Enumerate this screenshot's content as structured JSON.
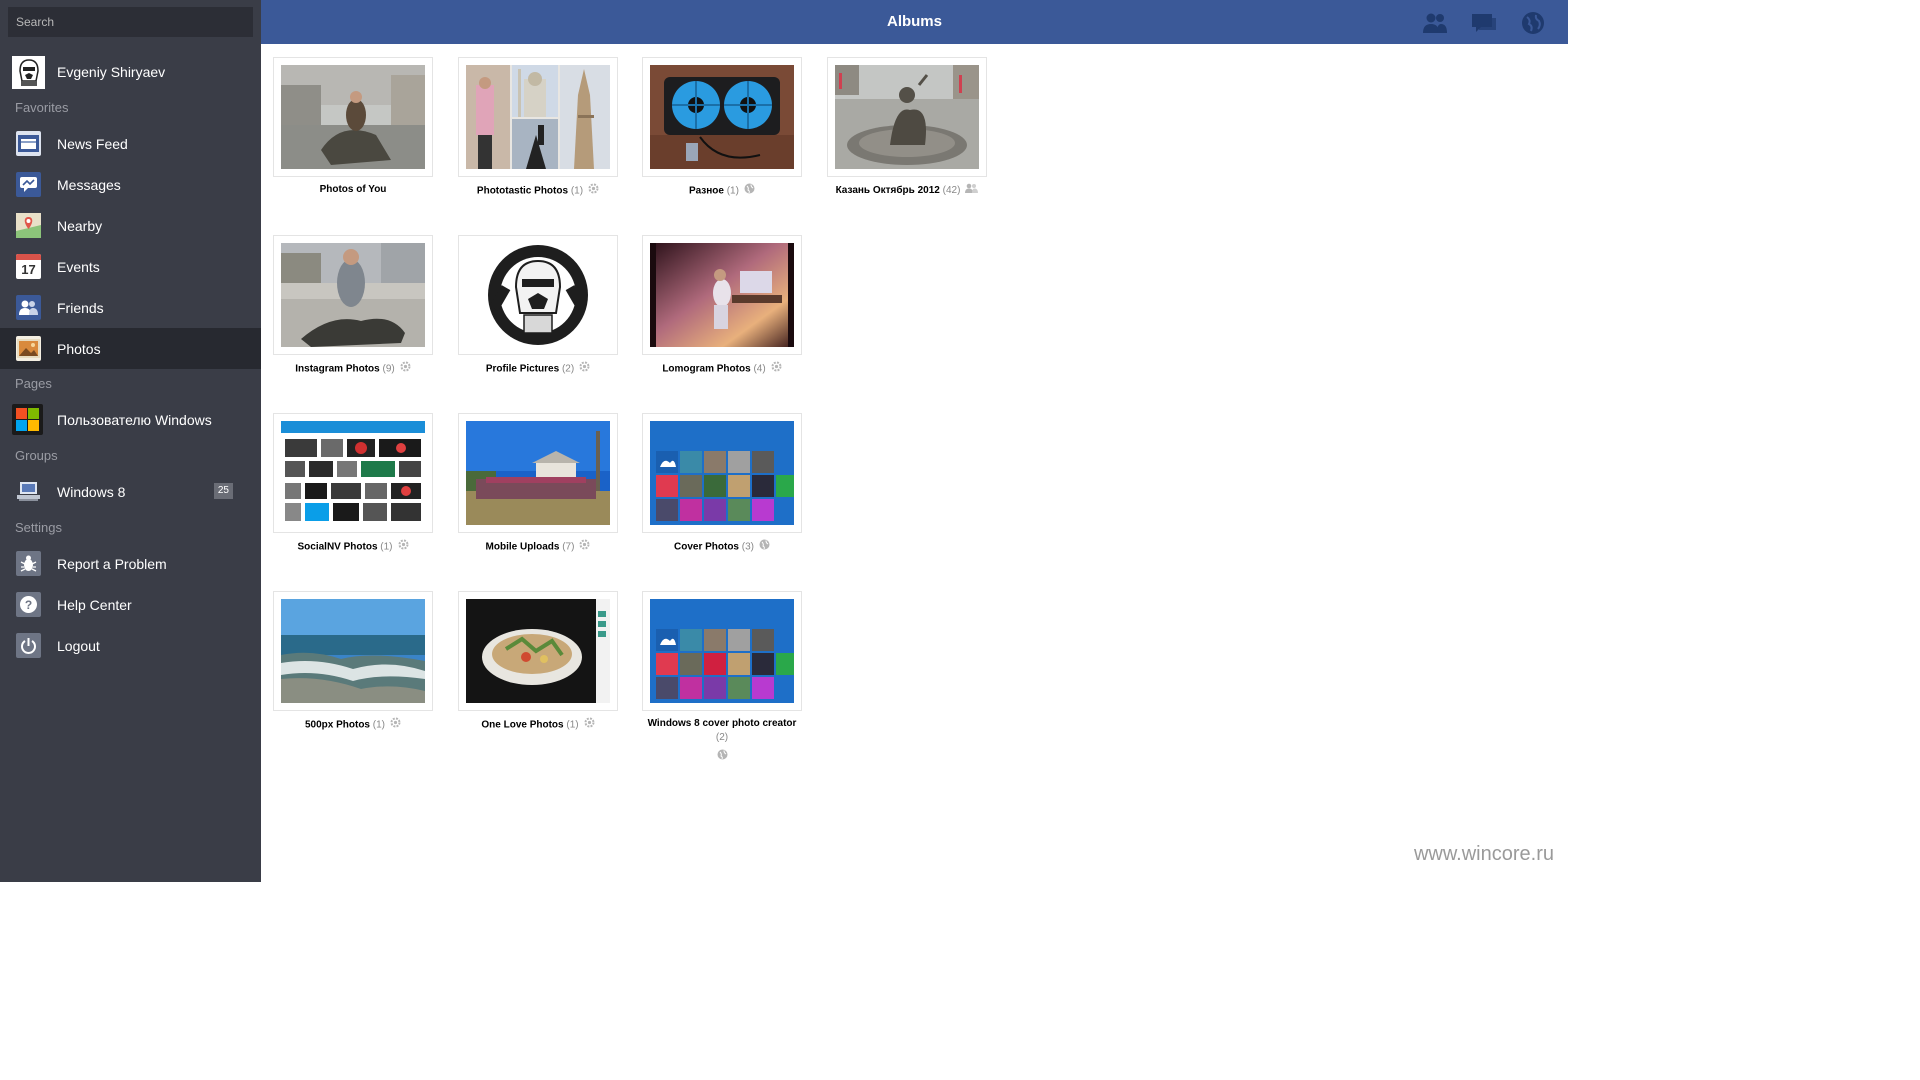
{
  "search": {
    "placeholder": "Search"
  },
  "profile": {
    "name": "Evgeniy  Shiryaev"
  },
  "sections": {
    "favorites": "Favorites",
    "pages": "Pages",
    "groups": "Groups",
    "settings": "Settings"
  },
  "nav": {
    "news_feed": "News Feed",
    "messages": "Messages",
    "nearby": "Nearby",
    "events": "Events",
    "events_icon_day": "17",
    "friends": "Friends",
    "photos": "Photos"
  },
  "pages_item": "Пользователю Windows",
  "groups_item": {
    "label": "Windows 8",
    "badge": "25"
  },
  "settings_items": {
    "report": "Report a Problem",
    "help": "Help Center",
    "logout": "Logout"
  },
  "header": {
    "title": "Albums"
  },
  "albums": [
    {
      "title": "Photos of You",
      "count": "",
      "privacy": ""
    },
    {
      "title": "Phototastic Photos",
      "count": "(1)",
      "privacy": "gear-icon"
    },
    {
      "title": "Разное",
      "count": "(1)",
      "privacy": "globe-icon"
    },
    {
      "title": "Казань Октябрь 2012",
      "count": "(42)",
      "privacy": "friends-icon"
    },
    {
      "title": "Instagram Photos",
      "count": "(9)",
      "privacy": "gear-icon"
    },
    {
      "title": "Profile Pictures",
      "count": "(2)",
      "privacy": "gear-icon"
    },
    {
      "title": "Lomogram Photos",
      "count": "(4)",
      "privacy": "gear-icon"
    },
    {
      "title": "SocialNV Photos",
      "count": "(1)",
      "privacy": "gear-icon"
    },
    {
      "title": "Mobile Uploads",
      "count": "(7)",
      "privacy": "gear-icon"
    },
    {
      "title": "Cover Photos",
      "count": "(3)",
      "privacy": "globe-icon"
    },
    {
      "title": "500px Photos",
      "count": "(1)",
      "privacy": "gear-icon"
    },
    {
      "title": "One Love Photos",
      "count": "(1)",
      "privacy": "gear-icon"
    },
    {
      "title": "Windows 8 cover photo creator",
      "count": "(2)",
      "privacy": "globe-icon"
    }
  ],
  "watermark": "www.wincore.ru",
  "colors": {
    "header": "#3b5998",
    "sidebar": "#3a3d47",
    "sidebar_active": "#272930"
  }
}
